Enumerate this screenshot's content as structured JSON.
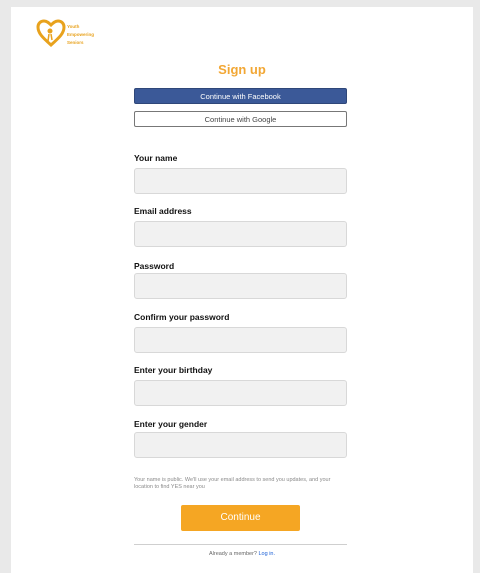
{
  "logo": {
    "lines": [
      "Youth",
      "Empowering",
      "Seniors"
    ],
    "color": "#e8a21d"
  },
  "signup": {
    "title": "Sign up",
    "facebook_label": "Continue with Facebook",
    "google_label": "Continue with Google"
  },
  "form": {
    "name_label": "Your name",
    "email_label": "Email address",
    "password_label": "Password",
    "confirm_label": "Confirm your password",
    "birthday_label": "Enter your birthday",
    "gender_label": "Enter your gender"
  },
  "note": "Your name is public. We'll use your email address to send you updates, and your location to find YES near you",
  "continue_label": "Continue",
  "footer": {
    "prompt": "Already a member?",
    "login_label": "Log in."
  },
  "colors": {
    "accent": "#f5a623",
    "facebook": "#3b5998",
    "link": "#1a5fd6"
  }
}
